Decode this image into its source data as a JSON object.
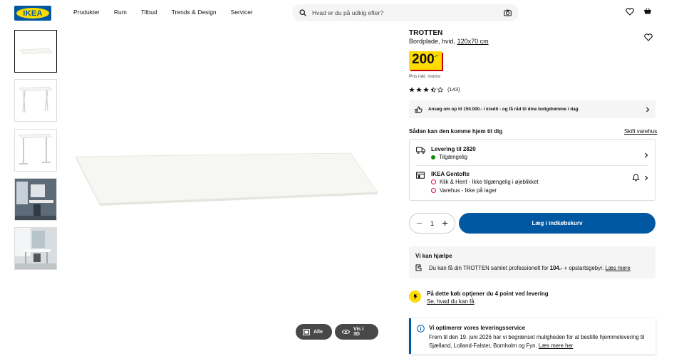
{
  "header": {
    "logo_text": "IKEA",
    "nav": [
      "Produkter",
      "Rum",
      "Tilbud",
      "Trends & Design",
      "Servicer"
    ],
    "search_placeholder": "Hvad er du på udkig efter?"
  },
  "gallery": {
    "thumbnails": [
      "tabletop",
      "desk-trestle",
      "desk-frame",
      "office-room",
      "office-room-2"
    ],
    "buttons": {
      "all": "Alle",
      "view3d": "Vis i 3D"
    }
  },
  "product": {
    "name": "TROTTEN",
    "desc": "Bordplade, hvid,",
    "size": "120x70 cm",
    "price": "200",
    "price_suffix": ".-",
    "price_note": "Pris inkl. moms",
    "rating_stars": 3.5,
    "rating_count": "(143)"
  },
  "credit": {
    "text": "Ansøg om op til 150.000.- i kredit - og få råd til dine boligdrømme i dag"
  },
  "delivery": {
    "heading": "Sådan kan den komme hjem til dig",
    "change_store": "Skift varehus",
    "home": {
      "title": "Levering til 2820",
      "status": "Tilgængelig"
    },
    "store": {
      "title": "IKEA Gentofte",
      "click_collect": "Klik & Hent - Ikke tilgængelig i øjeblikket",
      "warehouse": "Varehus - Ikke på lager"
    }
  },
  "cart": {
    "quantity": "1",
    "add_label": "Læg i indkøbskurv"
  },
  "help": {
    "heading": "Vi kan hjælpe",
    "text_pre": "Du kan få din TROTTEN samlet professionelt for ",
    "price": "104.-",
    "text_post": " + opstartsgebyr.",
    "link": "Læs mere"
  },
  "points": {
    "heading": "På dette køb optjener du 4 point ved levering",
    "link": "Se, hvad du kan få"
  },
  "notice": {
    "heading": "Vi optimerer vores leveringsservice",
    "text": "Frem til den 19. juni 2026 har vi begrænset muligheden for at bestille hjemmelevering til Sjælland, Lolland-Falster, Bornholm og Fyn.",
    "link": "Læs mere her"
  },
  "colors": {
    "brand_blue": "#0058a3",
    "brand_yellow": "#ffdb00",
    "available": "#0a8a00",
    "unavailable": "#e00751"
  }
}
